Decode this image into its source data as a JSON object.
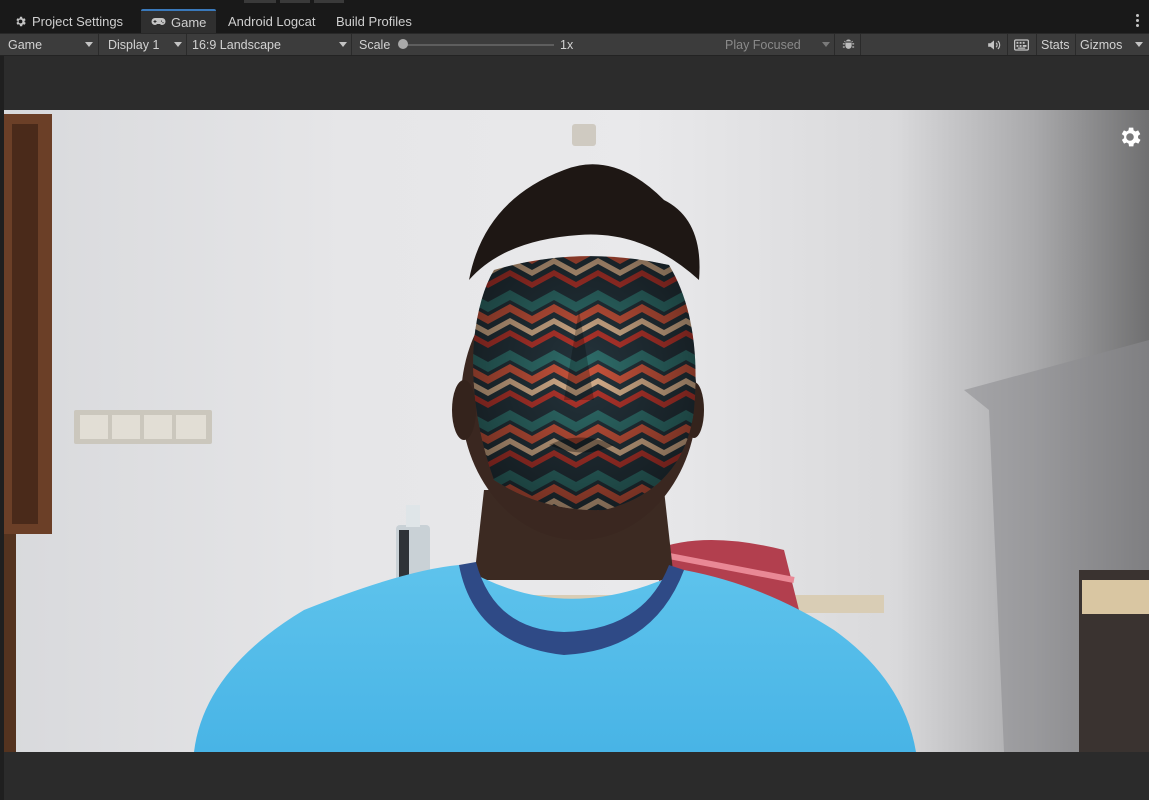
{
  "tabs": [
    {
      "label": "Project Settings",
      "icon": "gear-icon"
    },
    {
      "label": "Game",
      "icon": "gamepad-icon",
      "active": true
    },
    {
      "label": "Android Logcat"
    },
    {
      "label": "Build Profiles"
    }
  ],
  "toolbar": {
    "view_mode": "Game",
    "display": "Display 1",
    "aspect": "16:9 Landscape",
    "scale_label": "Scale",
    "scale_value": "1x",
    "scale_level": 0.0,
    "play_mode": "Play Focused",
    "stats": "Stats",
    "gizmos": "Gizmos",
    "icons": [
      "bug-icon",
      "speaker-icon",
      "keyboard-icon",
      "kebab-menu-icon"
    ]
  },
  "viewport": {
    "overlay_icon": "settings-gear-icon"
  },
  "colors": {
    "tab_accent": "#3a79bb",
    "toolbar_bg": "#3c3c3c",
    "tabbar_bg": "#191919"
  }
}
